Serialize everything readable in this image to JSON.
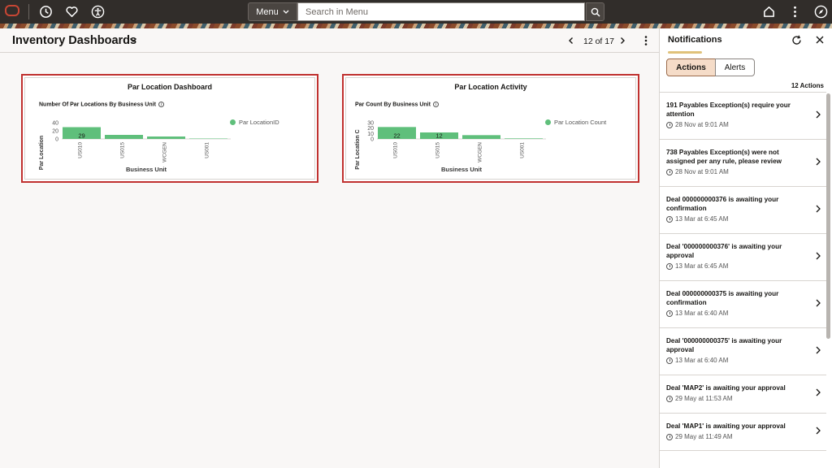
{
  "header": {
    "menu_label": "Menu",
    "search_placeholder": "Search in Menu"
  },
  "page": {
    "title": "Inventory Dashboards",
    "pager": "12 of 17"
  },
  "tiles": [
    {
      "title": "Par Location Dashboard",
      "chart_title": "Number Of Par Locations By Business Unit",
      "legend": "Par LocationID"
    },
    {
      "title": "Par Location Activity",
      "chart_title": "Par Count By Business Unit",
      "legend": "Par Location Count"
    }
  ],
  "chart_data": [
    {
      "type": "bar",
      "title": "Number Of Par Locations By Business Unit",
      "xlabel": "Business Unit",
      "ylabel": "Par Location",
      "categories": [
        "US010",
        "US015",
        "WCGEN",
        "US001"
      ],
      "series": [
        {
          "name": "Par LocationID",
          "values": [
            29,
            10,
            6,
            1
          ]
        }
      ],
      "data_labels": [
        "29",
        "",
        "",
        ""
      ],
      "yticks": [
        "0",
        "20",
        "40"
      ],
      "ylim": [
        0,
        40
      ],
      "color": "#5fbf7b",
      "legend": "right"
    },
    {
      "type": "bar",
      "title": "Par Count By Business Unit",
      "xlabel": "Business Unit",
      "ylabel": "Par Location C",
      "categories": [
        "US010",
        "US015",
        "WCGEN",
        "US001"
      ],
      "series": [
        {
          "name": "Par Location Count",
          "values": [
            22,
            12,
            7,
            1
          ]
        }
      ],
      "data_labels": [
        "22",
        "12",
        "",
        ""
      ],
      "yticks": [
        "0",
        "10",
        "20",
        "30"
      ],
      "ylim": [
        0,
        30
      ],
      "color": "#5fbf7b",
      "legend": "right"
    }
  ],
  "notifications": {
    "title": "Notifications",
    "tab_actions": "Actions",
    "tab_alerts": "Alerts",
    "count": "12 Actions",
    "items": [
      {
        "message": "191 Payables Exception(s) require your attention",
        "time": "28 Nov at 9:01 AM"
      },
      {
        "message": "738 Payables Exception(s) were not assigned per any rule, please review",
        "time": "28 Nov at 9:01 AM"
      },
      {
        "message": "Deal 000000000376 is awaiting your confirmation",
        "time": "13 Mar at 6:45 AM"
      },
      {
        "message": "Deal '000000000376' is awaiting your approval",
        "time": "13 Mar at 6:45 AM"
      },
      {
        "message": "Deal 000000000375 is awaiting your confirmation",
        "time": "13 Mar at 6:40 AM"
      },
      {
        "message": "Deal '000000000375' is awaiting your approval",
        "time": "13 Mar at 6:40 AM"
      },
      {
        "message": "Deal 'MAP2' is awaiting your approval",
        "time": "29 May at 11:53 AM"
      },
      {
        "message": "Deal 'MAP1' is awaiting your approval",
        "time": "29 May at 11:49 AM"
      }
    ]
  }
}
